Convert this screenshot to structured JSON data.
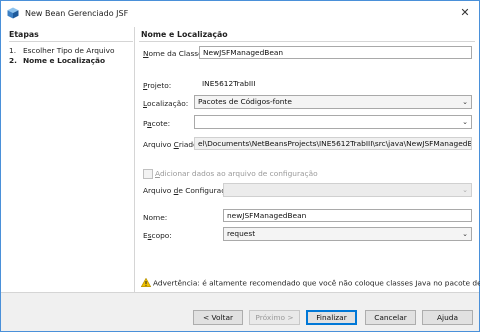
{
  "window": {
    "title": "New Bean Gerenciado JSF",
    "close_glyph": "✕"
  },
  "steps": {
    "heading": "Etapas",
    "items": [
      {
        "num": "1.",
        "label": "Escolher Tipo de Arquivo"
      },
      {
        "num": "2.",
        "label": "Nome e Localização"
      }
    ]
  },
  "panel": {
    "heading": "Nome e Localização",
    "class_name": {
      "label_u": "N",
      "label_rest": "ome da Classe:",
      "value": "NewJSFManagedBean"
    },
    "project": {
      "label_u": "P",
      "label_rest": "rojeto:",
      "value": "INE5612TrabIII"
    },
    "location": {
      "label_u": "L",
      "label_rest": "ocalização:",
      "value": "Pacotes de Códigos-fonte"
    },
    "package": {
      "label_u": "a",
      "label_pre": "P",
      "label_rest": "cote:",
      "value": ""
    },
    "created_file": {
      "label_pre": "Arquivo ",
      "label_u": "C",
      "label_rest": "riado:",
      "value": "el\\Documents\\NetBeansProjects\\INE5612TrabIII\\src\\java\\NewJSFManagedBean.java"
    },
    "add_config": {
      "label_u": "A",
      "label_rest": "dicionar dados ao arquivo de configuração",
      "checked": false
    },
    "config_file": {
      "label_pre": "Arquivo ",
      "label_u": "d",
      "label_rest": "e Configuração:",
      "value": ""
    },
    "name": {
      "label": "Nome:",
      "value": "newJSFManagedBean"
    },
    "scope": {
      "label_pre": "E",
      "label_u": "s",
      "label_rest": "copo:",
      "value": "request"
    },
    "warning": "Advertência: é altamente recomendado que você não coloque classes Java no pacote default."
  },
  "buttons": {
    "back": "< Voltar",
    "next": "Próximo >",
    "finish": "Finalizar",
    "cancel": "Cancelar",
    "help": "Ajuda"
  },
  "icons": {
    "title": "netbeans-cube-icon",
    "warning": "warning-triangle-icon",
    "dropdown": "chevron-down-icon",
    "accent": "#0078d7",
    "warning_color": "#f2c200"
  }
}
